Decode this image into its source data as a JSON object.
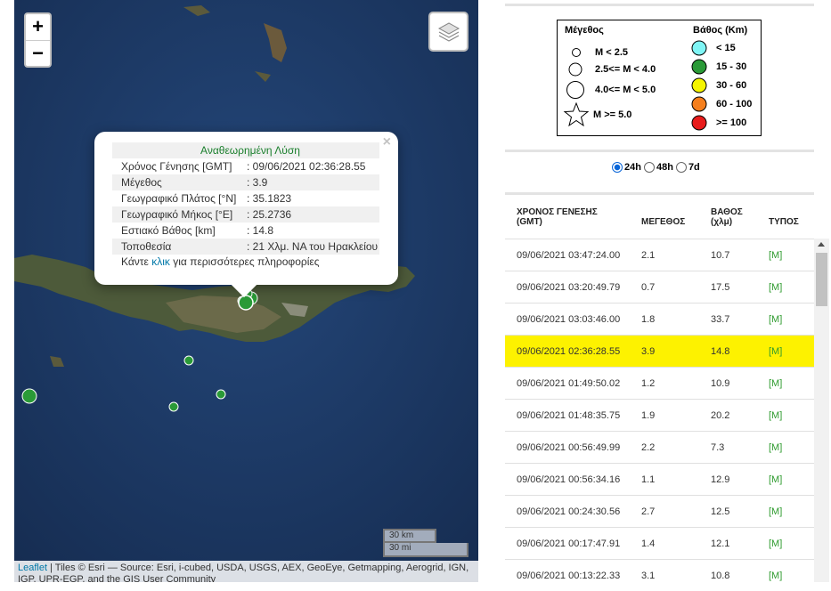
{
  "map": {
    "zoom_in": "+",
    "zoom_out": "−",
    "layers_icon": "layers-icon",
    "popup": {
      "title": "Αναθεωρημένη Λύση",
      "close": "×",
      "rows": [
        {
          "label": "Χρόνος Γένησης [GMT]",
          "value": ": 09/06/2021 02:36:28.55"
        },
        {
          "label": "Μέγεθος",
          "value": ": 3.9"
        },
        {
          "label": "Γεωγραφικό Πλάτος [°N]",
          "value": ": 35.1823"
        },
        {
          "label": "Γεωγραφικό Μήκος [°E]",
          "value": ": 25.2736"
        },
        {
          "label": "Εστιακό Βάθος [km]",
          "value": ": 14.8"
        },
        {
          "label": "Τοποθεσία",
          "value": ": 21 Χλμ. ΝΑ του Ηρακλείου"
        }
      ],
      "more_prefix": "Κάντε ",
      "more_link": "κλικ",
      "more_suffix": " για περισσότερες πληροφορίες"
    },
    "scale_km": "30 km",
    "scale_mi": "30 mi",
    "attribution_link": "Leaflet",
    "attribution_text": " | Tiles © Esri — Source: Esri, i-cubed, USDA, USGS, AEX, GeoEye, Getmapping, Aerogrid, IGN, IGP, UPR-EGP, and the GIS User Community"
  },
  "legend": {
    "magnitude_title": "Μέγεθος",
    "depth_title": "Βάθος (Km)",
    "magnitudes": [
      "M < 2.5",
      "2.5<= M < 4.0",
      "4.0<= M < 5.0",
      "M >= 5.0"
    ],
    "depths": [
      {
        "label": "< 15",
        "color": "#7ff5f5"
      },
      {
        "label": "15 - 30",
        "color": "#2a9a37"
      },
      {
        "label": "30 - 60",
        "color": "#f5f500"
      },
      {
        "label": "60 - 100",
        "color": "#f57f1d"
      },
      {
        "label": ">= 100",
        "color": "#e81c1c"
      }
    ]
  },
  "filters": {
    "options": [
      "24h",
      "48h",
      "7d"
    ],
    "selected": "24h"
  },
  "table": {
    "headers": {
      "time": "ΧΡΟΝΟΣ ΓΕΝΕΣΗΣ",
      "time_unit": "(GMT)",
      "mag": "ΜΕΓΕΘΟΣ",
      "depth": "ΒΑΘΟΣ",
      "depth_unit": "(χλμ)",
      "type": "ΤΥΠΟΣ"
    },
    "rows": [
      {
        "time": "09/06/2021 03:47:24.00",
        "mag": "2.1",
        "depth": "10.7",
        "type": "[M]"
      },
      {
        "time": "09/06/2021 03:20:49.79",
        "mag": "0.7",
        "depth": "17.5",
        "type": "[M]"
      },
      {
        "time": "09/06/2021 03:03:46.00",
        "mag": "1.8",
        "depth": "33.7",
        "type": "[M]"
      },
      {
        "time": "09/06/2021 02:36:28.55",
        "mag": "3.9",
        "depth": "14.8",
        "type": "[M]"
      },
      {
        "time": "09/06/2021 01:49:50.02",
        "mag": "1.2",
        "depth": "10.9",
        "type": "[M]"
      },
      {
        "time": "09/06/2021 01:48:35.75",
        "mag": "1.9",
        "depth": "20.2",
        "type": "[M]"
      },
      {
        "time": "09/06/2021 00:56:49.99",
        "mag": "2.2",
        "depth": "7.3",
        "type": "[M]"
      },
      {
        "time": "09/06/2021 00:56:34.16",
        "mag": "1.1",
        "depth": "12.9",
        "type": "[M]"
      },
      {
        "time": "09/06/2021 00:24:30.56",
        "mag": "2.7",
        "depth": "12.5",
        "type": "[M]"
      },
      {
        "time": "09/06/2021 00:17:47.91",
        "mag": "1.4",
        "depth": "12.1",
        "type": "[M]"
      },
      {
        "time": "09/06/2021 00:13:22.33",
        "mag": "3.1",
        "depth": "10.8",
        "type": "[M]"
      }
    ],
    "selected_row": "09/06/2021 02:36:28.55"
  }
}
